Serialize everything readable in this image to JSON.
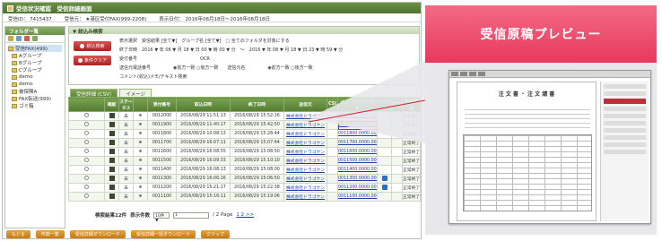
{
  "app": {
    "title": "受信状況確認　受信詳細画面",
    "info": [
      "受信ID： 7415437",
      "受信元： ★港区受付FAX(999-2208)",
      "表示日付： 2016年08月18日～2016年08月18日"
    ]
  },
  "folders": {
    "header": "フォルダ一覧",
    "items": [
      "受信FAX(499)",
      "Aグループ",
      "Bグループ",
      "Cグループ",
      "demo",
      "demo",
      "被保険A",
      "FAX転送(999)",
      "ゴミ箱"
    ]
  },
  "filter": {
    "header": "▼ 絞込み検索",
    "search_button": "絞込検索",
    "clear_button": "条件クリア",
    "rows": [
      "表示選択　受信結果 [全て▼]　グループ名 [全て▼]　□ 全てのフォルダを対象にする",
      "終了日時　2016 ▼ 年 08 ▼ 月 18 ▼ 日 00 ▼ 時 00 ▼ 分　～　2016 ▼ 年 08 ▼ 月 18 ▼ 日 23 ▼ 時 59 ▼ 分",
      "受付番号　　　　　　　　　　　　　　OCR",
      "送信元電話番号　　　　　◉前方一致 ○後方一致　　送信元名　　　　　◉前方一致 ○後方一致",
      "コメント(絞込)メモ/テキスト検索"
    ]
  },
  "tabs": [
    "受信詳細 (CSV)",
    "イメージ"
  ],
  "table": {
    "headers": [
      "",
      "確認",
      "ステータス",
      "受付番号",
      "取込日時",
      "終了日時",
      "送信元",
      "CSI",
      "イメージファイル名",
      "クリップ",
      "ExCel",
      "結果内容"
    ],
    "rows": [
      {
        "status": "未",
        "no": "0012000",
        "start": "2016/08/29 11:51:13",
        "end": "2016/08/29 15:52:16",
        "from": "株式会社ドラゴケン",
        "file": "0012000.0000.001.tif",
        "clip": false,
        "result": "正常終了"
      },
      {
        "status": "未",
        "no": "0011900",
        "start": "2016/08/29 11:40:17",
        "end": "2016/08/29 15:42:50",
        "from": "株式会社ドラゴケン",
        "file": "0011900.0000.001.tif",
        "clip": false,
        "result": "正常終了",
        "highlight": true
      },
      {
        "status": "未",
        "no": "0011800",
        "start": "2016/08/29 10:08:13",
        "end": "2016/08/29 15:28:44",
        "from": "株式会社ドラゴケン",
        "file": "0011800.0000.001.tif",
        "clip": false,
        "result": "正常終了"
      },
      {
        "status": "未",
        "no": "0011700",
        "start": "2016/08/29 16:07:11",
        "end": "2016/08/29 15:07:44",
        "from": "株式会社ドラゴケン",
        "file": "0011700.0000.001.tif",
        "clip": false,
        "result": "正常終了"
      },
      {
        "status": "未",
        "no": "0011600",
        "start": "2016/08/29 16:08:55",
        "end": "2016/08/29 15:08:50",
        "from": "株式会社ドラゴケン",
        "file": "0011600.0000.001.tif",
        "clip": false,
        "result": "正常終了"
      },
      {
        "status": "未",
        "no": "0011500",
        "start": "2016/08/29 16:09:33",
        "end": "2016/08/29 15:10:10",
        "from": "株式会社ドラゴケン",
        "file": "0011500.0000.001.tif",
        "clip": false,
        "result": "正常終了"
      },
      {
        "status": "未",
        "no": "0011400",
        "start": "2016/08/29 16:08:13",
        "end": "2016/08/29 15:08:00",
        "from": "株式会社ドラゴケン",
        "file": "0011400.0000.001.tif",
        "clip": false,
        "result": "正常終了"
      },
      {
        "status": "未",
        "no": "0011300",
        "start": "2016/08/29 16:06:16",
        "end": "2016/08/29 15:06:50",
        "from": "株式会社ドラゴケン",
        "file": "0011300.0000.001.tif",
        "clip": true,
        "result": "正常終了"
      },
      {
        "status": "未",
        "no": "0011200",
        "start": "2016/08/29 15:21:17",
        "end": "2016/08/29 15:22:38",
        "from": "株式会社ドラゴケン",
        "file": "0011200.0000.001.tif",
        "clip": true,
        "result": "正常終了"
      },
      {
        "status": "未",
        "no": "0011100",
        "start": "2016/08/29 15:16:11",
        "end": "2016/08/29 15:19:06",
        "from": "株式会社ドラゴケン",
        "file": "0011100.0000.001.tif",
        "clip": false,
        "result": "正常終了"
      }
    ]
  },
  "pager": {
    "total": "検索結果12件",
    "per_page_label": "表示件数",
    "per_page": "10件 ▼",
    "page": "1",
    "pages": "/ 2 Page",
    "links": "1  2  >>"
  },
  "footer": [
    "もどる",
    "件数一覧",
    "受信詳細ダウンロード",
    "受信詳細一括ダウンロード",
    "クリップ"
  ],
  "callout": {
    "title": "受信原稿プレビュー",
    "color": "#e8395c",
    "preview_doc_title": "注 文 書 ・ 注 文 請 書"
  }
}
